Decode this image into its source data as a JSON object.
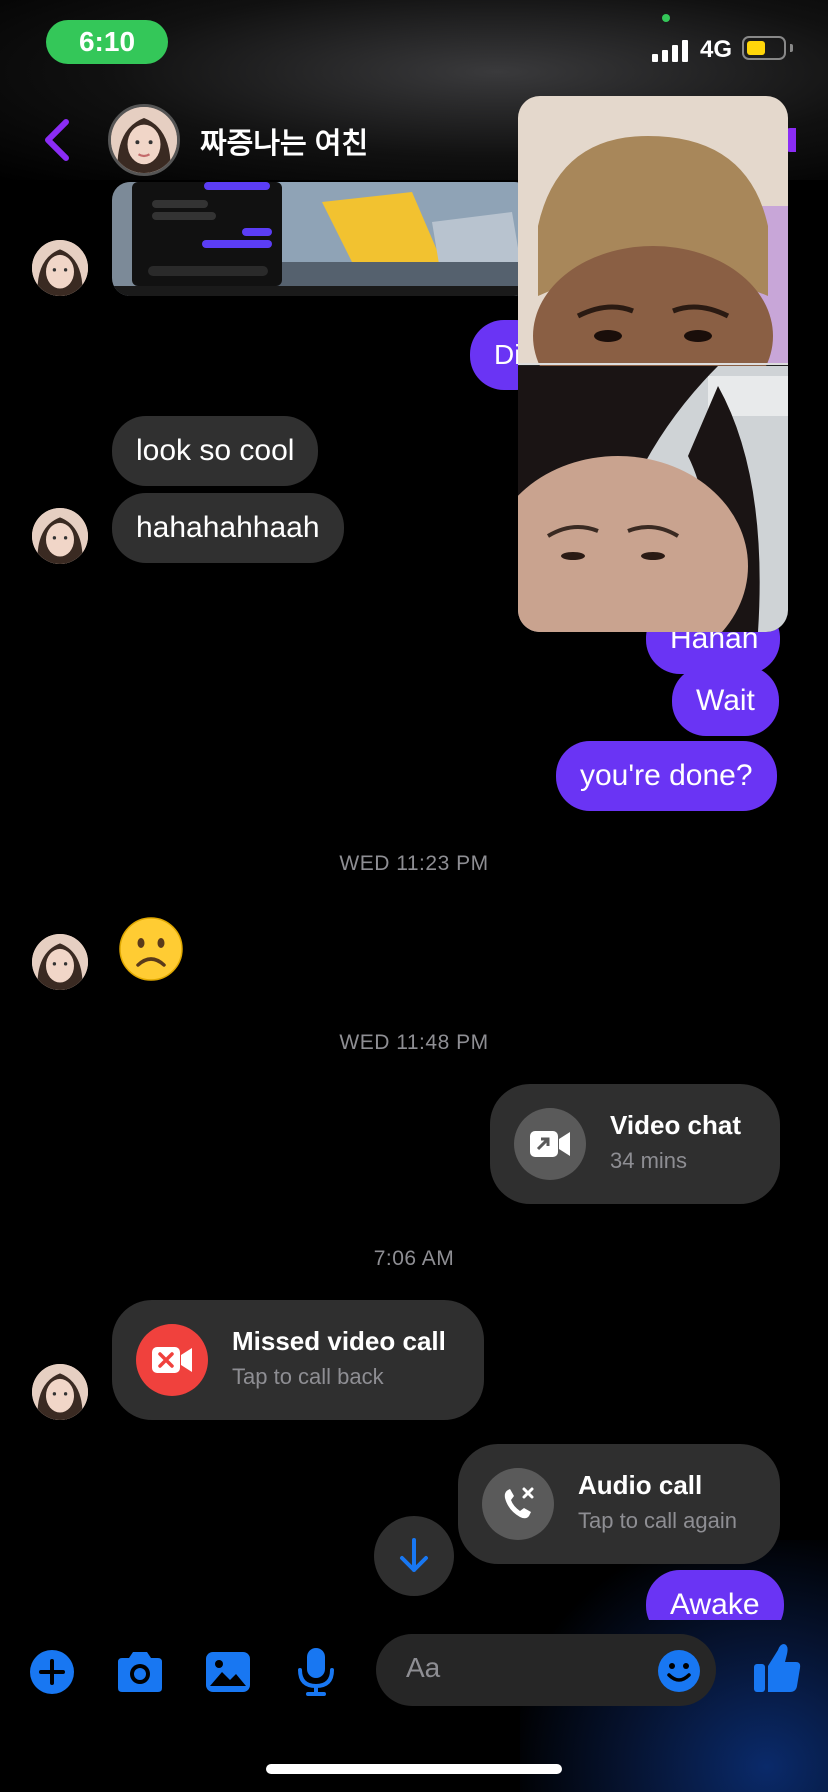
{
  "status": {
    "time": "6:10",
    "network": "4G"
  },
  "header": {
    "contact_name": "짜증나는 여친"
  },
  "thumbnail": {
    "rows": [
      "What's that?",
      "I will update wait",
      "okay",
      "you didn't update yet?",
      "Type a message...",
      "Compiling resources... 86%"
    ]
  },
  "messages": {
    "in_1": "look so cool",
    "in_2": "hahahahhaah",
    "out_partial": "Hahah",
    "out_wait": "Wait",
    "out_done": "you're done?",
    "sad_emoji": "☹️"
  },
  "stamps": {
    "s1": "WED 11:23 PM",
    "s2": "WED 11:48 PM",
    "s3": "7:06 AM"
  },
  "calls": {
    "video_chat": {
      "title": "Video chat",
      "sub": "34 mins"
    },
    "missed": {
      "title": "Missed video call",
      "sub": "Tap to call back"
    },
    "audio": {
      "title": "Audio call",
      "sub": "Tap to call again"
    }
  },
  "last_message": "Awake",
  "composer": {
    "placeholder": "Aa"
  },
  "colors": {
    "accent": "#6a34f4",
    "icon_blue": "#1877f2",
    "missed_red": "#f0413d",
    "status_green": "#34c759"
  }
}
